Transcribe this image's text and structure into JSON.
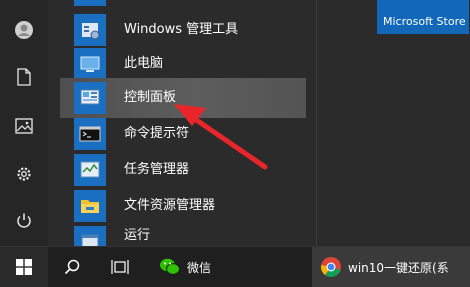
{
  "menu": {
    "items": [
      {
        "label": "Windows 管理工具",
        "icon": "admin-tools-icon"
      },
      {
        "label": "此电脑",
        "icon": "this-pc-icon"
      },
      {
        "label": "控制面板",
        "icon": "control-panel-icon",
        "highlighted": true
      },
      {
        "label": "命令提示符",
        "icon": "cmd-icon"
      },
      {
        "label": "任务管理器",
        "icon": "task-manager-icon"
      },
      {
        "label": "文件资源管理器",
        "icon": "file-explorer-icon"
      },
      {
        "label": "运行",
        "icon": "run-icon"
      }
    ]
  },
  "tiles": {
    "store_label": "Microsoft Store"
  },
  "left_rail": {
    "icons": [
      "user-avatar-icon",
      "documents-icon",
      "pictures-icon",
      "settings-icon",
      "power-icon"
    ]
  },
  "taskbar": {
    "wechat_label": "微信",
    "chrome_label": "win10一键还原(系"
  },
  "colors": {
    "tile_blue": "#1a6fc0",
    "arrow_red": "#e8262a",
    "taskbar_bg": "#1f1f1f",
    "menu_bg": "#2b2b2b"
  }
}
